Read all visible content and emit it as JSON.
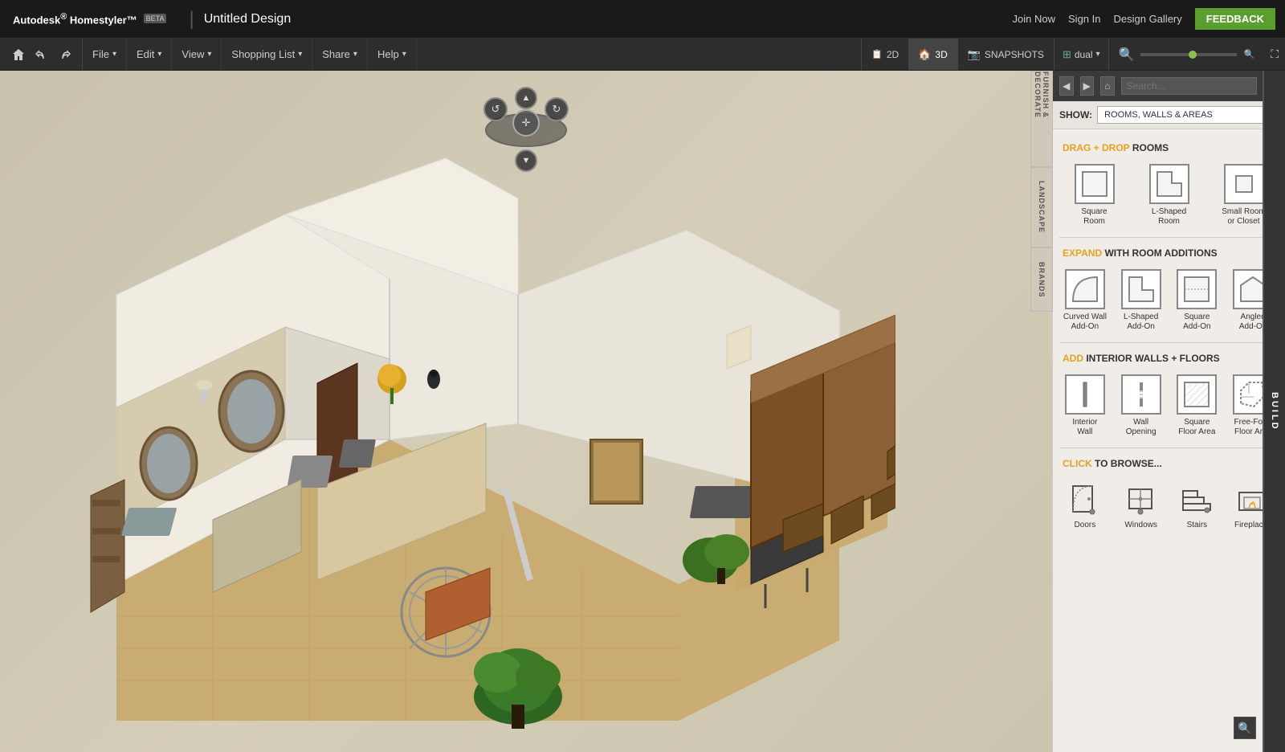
{
  "app": {
    "name": "Autodesk® Homestyler™",
    "beta_label": "BETA",
    "title": "Untitled Design",
    "title_separator": "|"
  },
  "top_nav": {
    "join_now": "Join Now",
    "sign_in": "Sign In",
    "design_gallery": "Design Gallery",
    "feedback": "FEEDBACK"
  },
  "toolbar": {
    "menus": [
      {
        "label": "File",
        "id": "file-menu"
      },
      {
        "label": "Edit",
        "id": "edit-menu"
      },
      {
        "label": "View",
        "id": "view-menu"
      },
      {
        "label": "Shopping List",
        "id": "shopping-menu"
      },
      {
        "label": "Share",
        "id": "share-menu"
      },
      {
        "label": "Help",
        "id": "help-menu"
      }
    ],
    "view_2d": "2D",
    "view_3d": "3D",
    "snapshots": "SNAPSHOTS",
    "dual": "dual"
  },
  "panel": {
    "build_tab": "BUILD",
    "side_tabs": [
      {
        "label": "FURNISH & DECORATE",
        "id": "furnish"
      },
      {
        "label": "LANDSCAPE",
        "id": "landscape"
      },
      {
        "label": "BRANDS",
        "id": "brands"
      }
    ],
    "show_label": "SHOW:",
    "show_options": [
      "ROOMS, WALLS & AREAS"
    ],
    "show_selected": "ROOMS, WALLS & AREAS",
    "sections": {
      "drag_drop_rooms": {
        "prefix": "DRAG + DROP",
        "suffix": "ROOMS",
        "items": [
          {
            "label": "Square\nRoom",
            "shape": "square"
          },
          {
            "label": "L-Shaped\nRoom",
            "shape": "l-shaped"
          },
          {
            "label": "Small Room\nor Closet",
            "shape": "small"
          }
        ]
      },
      "expand_room_additions": {
        "prefix": "EXPAND",
        "suffix": "WITH ROOM ADDITIONS",
        "items": [
          {
            "label": "Curved Wall\nAdd-On",
            "shape": "curved"
          },
          {
            "label": "L-Shaped\nAdd-On",
            "shape": "l-addon"
          },
          {
            "label": "Square\nAdd-On",
            "shape": "sq-addon"
          },
          {
            "label": "Angled\nAdd-On",
            "shape": "angled"
          }
        ]
      },
      "interior_walls": {
        "prefix": "ADD",
        "suffix": "INTERIOR WALLS + FLOORS",
        "items": [
          {
            "label": "Interior\nWall",
            "shape": "wall"
          },
          {
            "label": "Wall\nOpening",
            "shape": "opening"
          },
          {
            "label": "Square\nFloor Area",
            "shape": "floor-sq"
          },
          {
            "label": "Free-Form\nFloor Area",
            "shape": "freeform"
          }
        ]
      },
      "browse": {
        "prefix": "CLICK",
        "suffix": "TO BROWSE...",
        "items": [
          {
            "label": "Doors",
            "icon": "door"
          },
          {
            "label": "Windows",
            "icon": "window"
          },
          {
            "label": "Stairs",
            "icon": "stairs"
          },
          {
            "label": "Fireplaces",
            "icon": "fireplace"
          }
        ]
      }
    }
  },
  "colors": {
    "accent_orange": "#e8a020",
    "accent_green": "#5a9e2f",
    "bg_dark": "#1a1a1a",
    "bg_toolbar": "#2d2d2d",
    "panel_bg": "#f0ede8",
    "canvas_bg": "#d4cdb8"
  }
}
